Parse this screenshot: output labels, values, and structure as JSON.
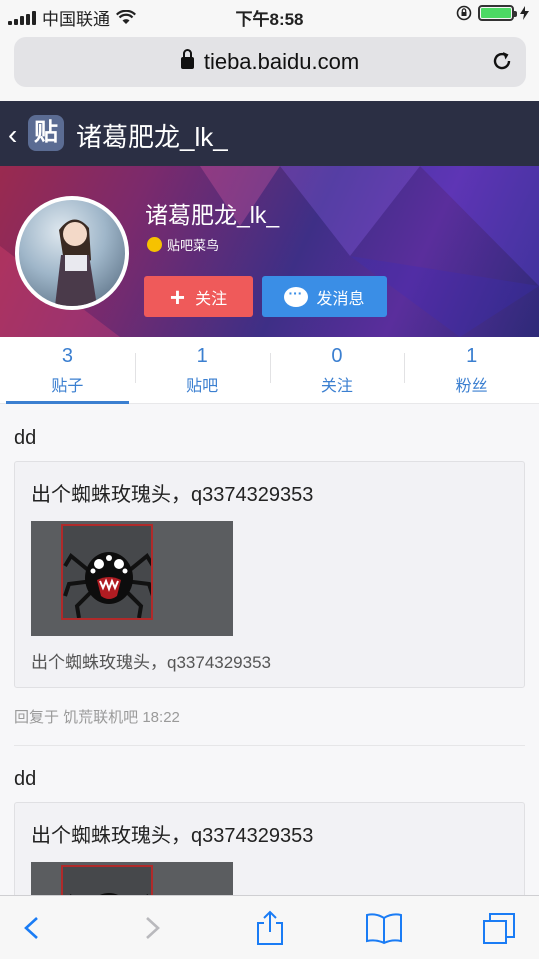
{
  "status_bar": {
    "carrier": "中国联通",
    "time": "下午8:58"
  },
  "browser": {
    "url": "tieba.baidu.com"
  },
  "header": {
    "title": "诸葛肥龙_lk_",
    "logo_text": "贴"
  },
  "profile": {
    "name": "诸葛肥龙_lk_",
    "level": "贴吧菜鸟",
    "follow_label": "关注",
    "message_label": "发消息"
  },
  "stats": [
    {
      "num": "3",
      "label": "贴子"
    },
    {
      "num": "1",
      "label": "贴吧"
    },
    {
      "num": "0",
      "label": "关注"
    },
    {
      "num": "1",
      "label": "粉丝"
    }
  ],
  "posts": [
    {
      "title": "dd",
      "quote_title": "出个蜘蛛玫瑰头，q3374329353",
      "quote_sub": "出个蜘蛛玫瑰头，q3374329353",
      "meta": "回复于 饥荒联机吧 18:22"
    },
    {
      "title": "dd",
      "quote_title": "出个蜘蛛玫瑰头，q3374329353"
    }
  ],
  "colors": {
    "header_bg": "#2b2f44",
    "follow": "#ef5a5a",
    "message": "#3a8ee6",
    "accent": "#3b7fd0"
  }
}
